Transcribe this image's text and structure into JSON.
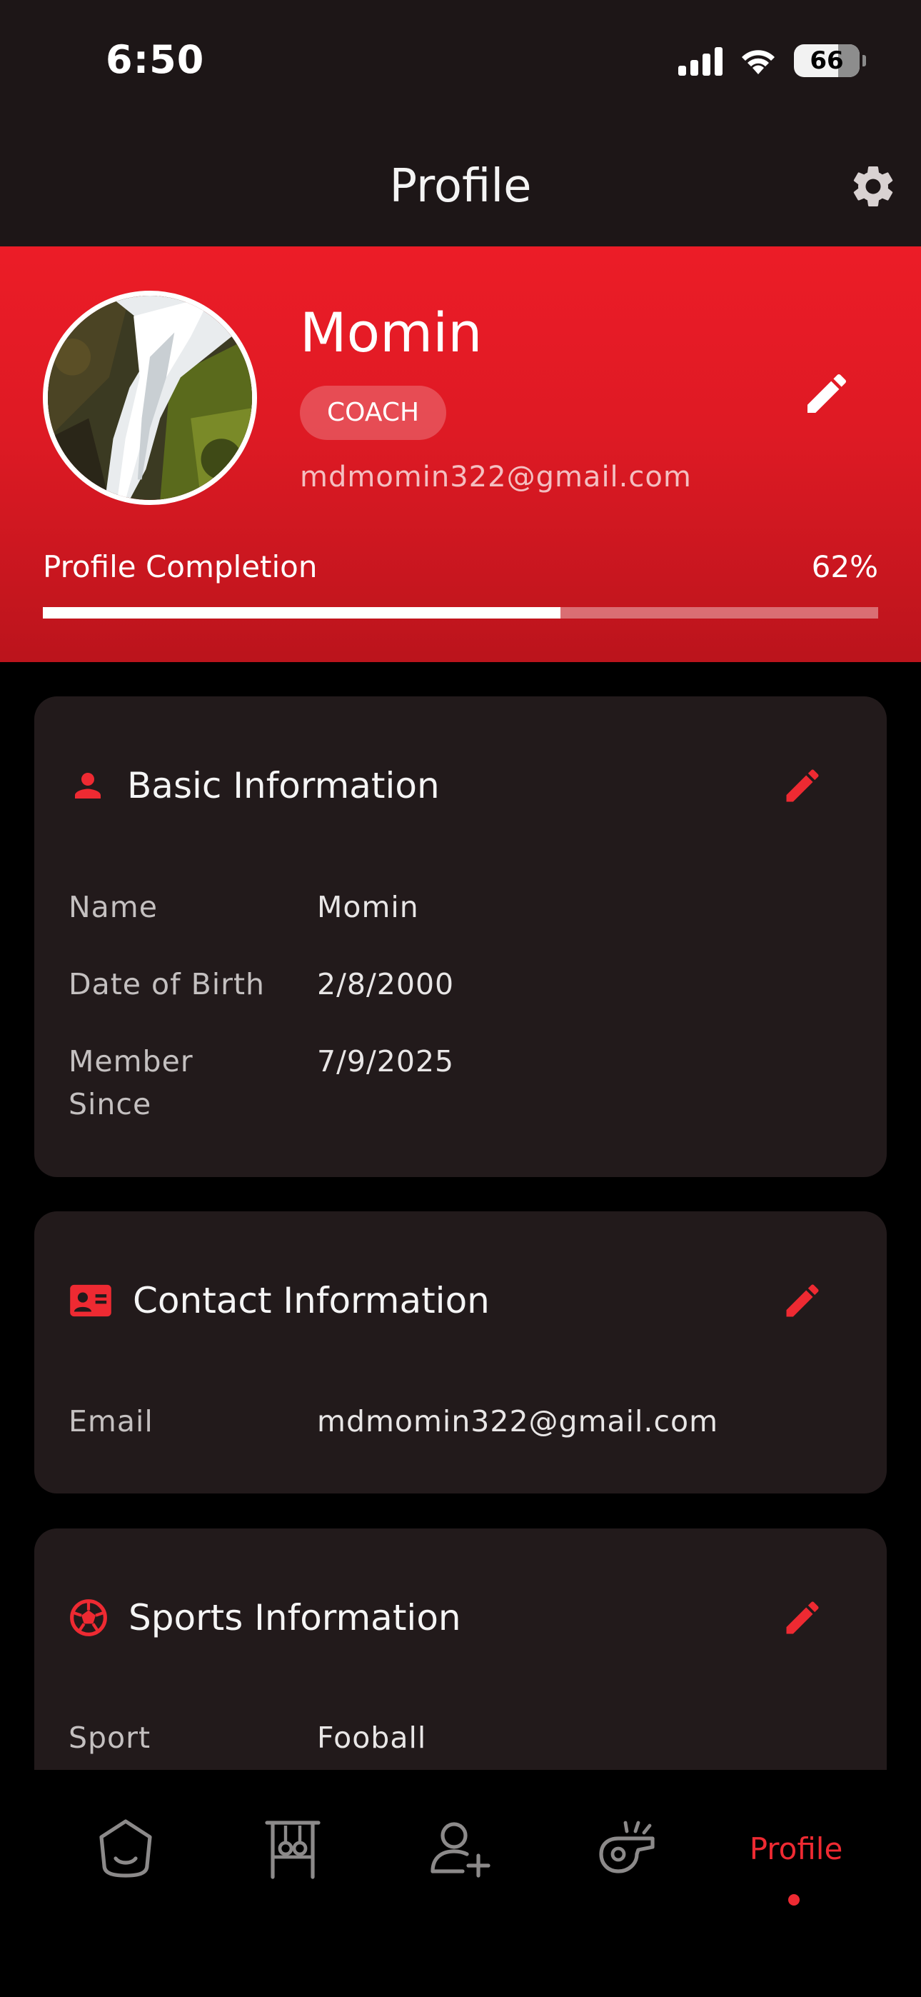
{
  "status_bar": {
    "time": "6:50",
    "battery": "66"
  },
  "header": {
    "title": "Profile",
    "settings_icon": "gear-icon"
  },
  "profile": {
    "name": "Momin",
    "role": "COACH",
    "email": "mdmomin322@gmail.com",
    "completion_label": "Profile Completion",
    "completion_text": "62%",
    "completion_fraction": 0.62
  },
  "sections": {
    "basic": {
      "title": "Basic Information",
      "icon": "person-icon",
      "rows": [
        {
          "label": "Name",
          "value": "Momin"
        },
        {
          "label": "Date of Birth",
          "value": "2/8/2000"
        },
        {
          "label": "Member Since",
          "value": "7/9/2025"
        }
      ]
    },
    "contact": {
      "title": "Contact Information",
      "icon": "contact-card-icon",
      "rows": [
        {
          "label": "Email",
          "value": "mdmomin322@gmail.com"
        }
      ]
    },
    "sports": {
      "title": "Sports Information",
      "icon": "soccer-ball-icon",
      "rows": [
        {
          "label": "Sport",
          "value": "Fooball"
        }
      ]
    }
  },
  "bottom_nav": {
    "items": [
      {
        "icon": "home-icon"
      },
      {
        "icon": "training-frame-icon"
      },
      {
        "icon": "add-user-icon"
      },
      {
        "icon": "whistle-icon"
      },
      {
        "label": "Profile",
        "active": true
      }
    ]
  },
  "colors": {
    "accent": "#EE2A32",
    "hero_red": "#E31B25",
    "card_bg": "#221A1B",
    "header_bg": "#1D1617"
  }
}
